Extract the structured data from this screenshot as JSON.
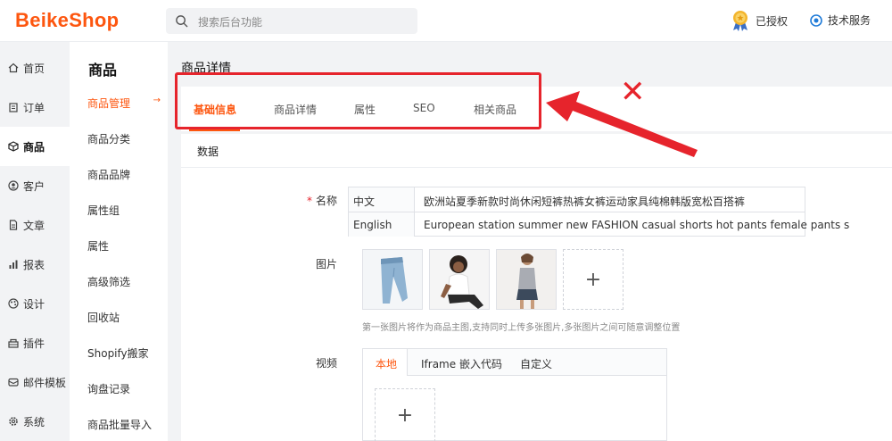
{
  "header": {
    "logo": "BeikeShop",
    "search_placeholder": "搜索后台功能",
    "authorized": "已授权",
    "tech_service": "技术服务"
  },
  "nav_primary": [
    {
      "label": "首页",
      "icon": "home-icon"
    },
    {
      "label": "订单",
      "icon": "clipboard-icon"
    },
    {
      "label": "商品",
      "icon": "box-icon",
      "active": true
    },
    {
      "label": "客户",
      "icon": "user-circle-icon"
    },
    {
      "label": "文章",
      "icon": "document-icon"
    },
    {
      "label": "报表",
      "icon": "bar-chart-icon"
    },
    {
      "label": "设计",
      "icon": "palette-icon"
    },
    {
      "label": "插件",
      "icon": "plugin-icon"
    },
    {
      "label": "邮件模板",
      "icon": "mail-icon"
    },
    {
      "label": "系统",
      "icon": "gear-icon"
    }
  ],
  "nav_secondary": {
    "title": "商品",
    "items": [
      "商品管理",
      "商品分类",
      "商品品牌",
      "属性组",
      "属性",
      "高级筛选",
      "回收站",
      "Shopify搬家",
      "询盘记录",
      "商品批量导入"
    ],
    "active_index": 0,
    "active_arrow": "→"
  },
  "main": {
    "page_title": "商品详情",
    "tabs": [
      "基础信息",
      "商品详情",
      "属性",
      "SEO",
      "相关商品"
    ],
    "active_tab": 0,
    "cross_mark": "✕",
    "card": {
      "title": "数据",
      "name_label": "名称",
      "name_required": "*",
      "names": [
        {
          "lang": "中文",
          "value": "欧洲站夏季新款时尚休闲短裤热裤女裤运动家具纯棉韩版宽松百搭裤"
        },
        {
          "lang": "English",
          "value": "European station summer new FASHION casual shorts hot pants female pants s"
        }
      ],
      "image_label": "图片",
      "image_add": "+",
      "image_hint": "第一张图片将作为商品主图,支持同时上传多张图片,多张图片之间可随意调整位置",
      "video_label": "视频",
      "video_tabs": [
        "本地",
        "Iframe 嵌入代码",
        "自定义"
      ],
      "video_add": "+"
    }
  },
  "colors": {
    "brand": "#fd560f",
    "annotation_red": "#e6242c"
  }
}
